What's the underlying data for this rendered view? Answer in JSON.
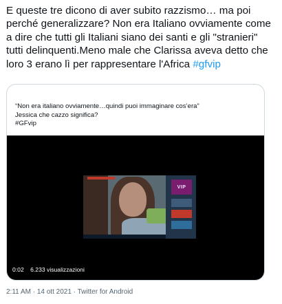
{
  "tweet": {
    "text": "E queste tre dicono di aver subito razzismo… ma poi perché generalizzare? Non era Italiano ovviamente come a dire che tutti gli Italiani siano dei santi e gli \"stranieri\" tutti delinquenti.Meno male che Clarissa aveva detto che loro 3 erano lì per rappresentare l'Africa ",
    "hashtag": "#gfvip"
  },
  "quoted": {
    "line1": "“Non era italiano ovviamente…quindi puoi immaginare cos’era”",
    "line2": "Jessica che cazzo significa?",
    "line3": "#GFvip"
  },
  "video": {
    "time": "0:02",
    "views": "6.233 visualizzazioni",
    "overlay_logo": "VIP"
  },
  "meta": {
    "time": "2:11 AM",
    "separator1": " · ",
    "date": "14 ott 2021",
    "separator2": " · ",
    "source": "Twitter for Android"
  }
}
